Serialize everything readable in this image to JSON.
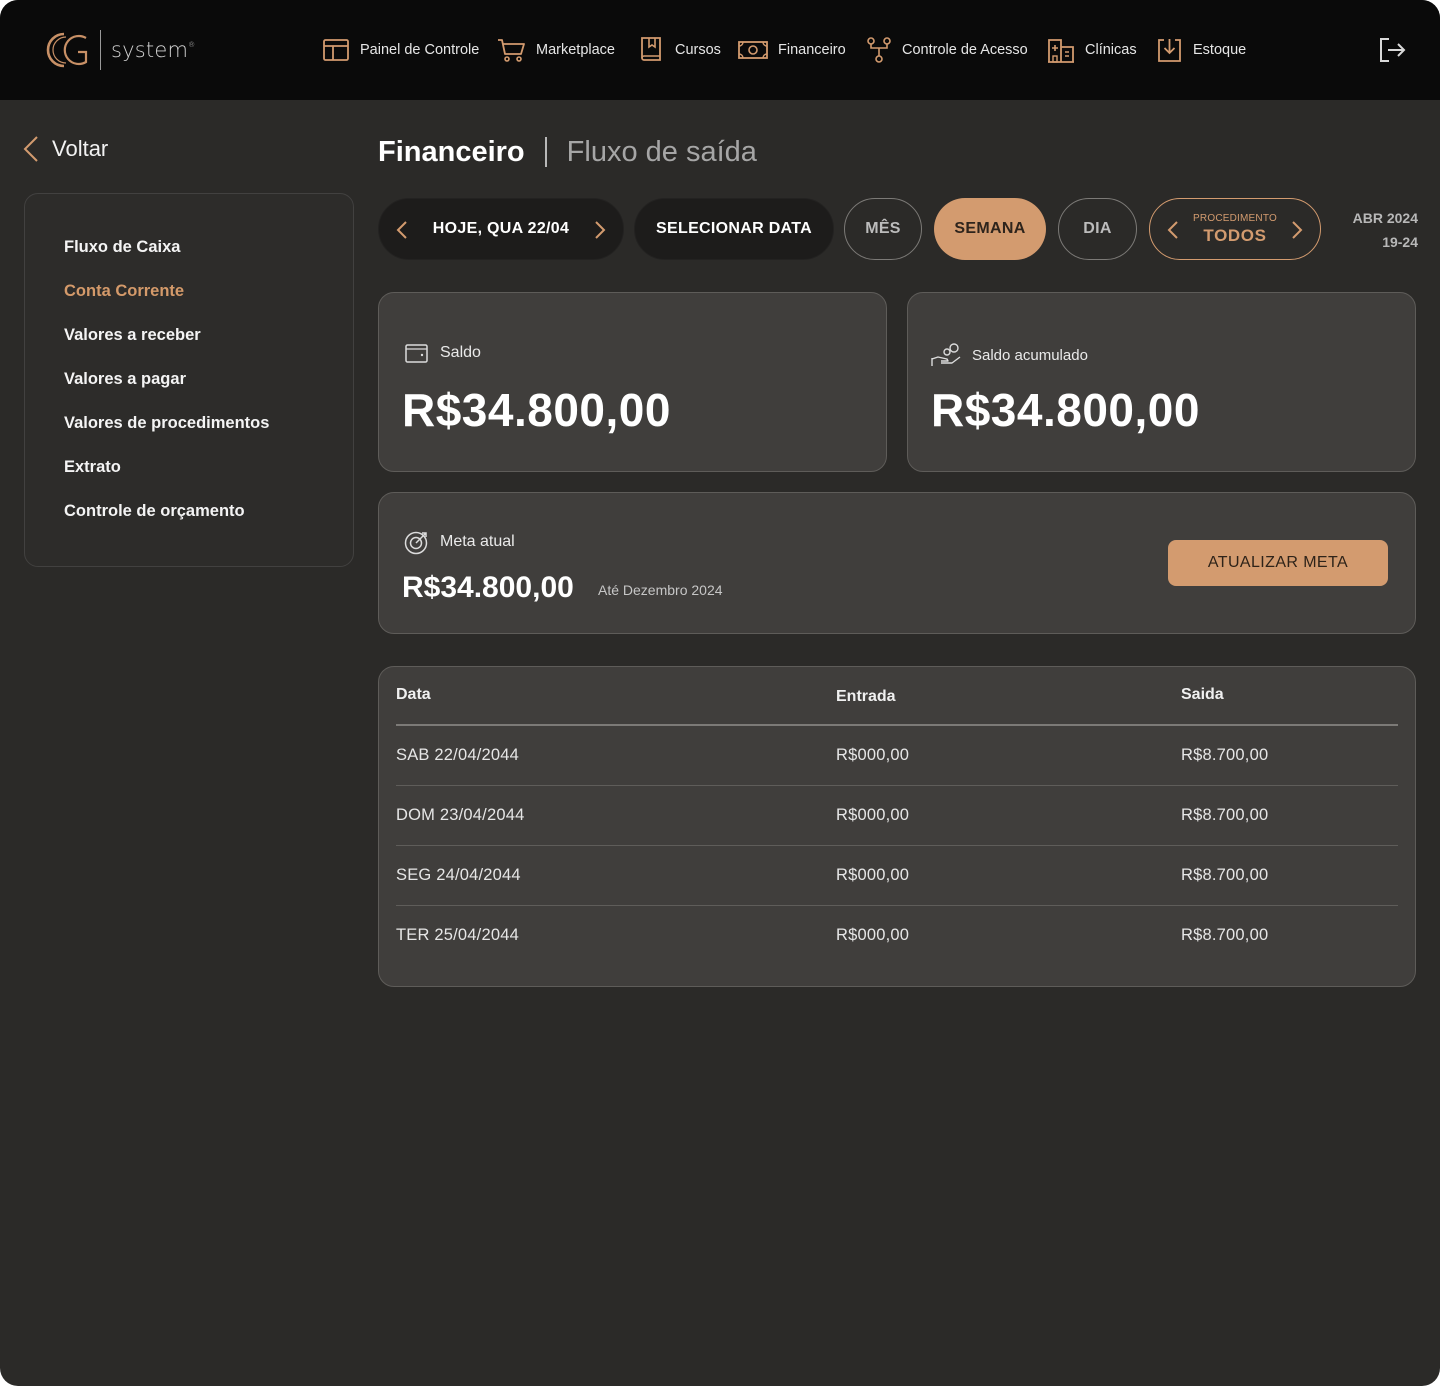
{
  "brand": {
    "name": "system",
    "mark": "®"
  },
  "nav": {
    "items": [
      {
        "label": "Painel de Controle",
        "icon": "layout-icon"
      },
      {
        "label": "Marketplace",
        "icon": "cart-icon"
      },
      {
        "label": "Cursos",
        "icon": "book-icon"
      },
      {
        "label": "Financeiro",
        "icon": "banknote-icon"
      },
      {
        "label": "Controle de Acesso",
        "icon": "network-icon"
      },
      {
        "label": "Clínicas",
        "icon": "building-icon"
      },
      {
        "label": "Estoque",
        "icon": "download-box-icon"
      }
    ],
    "logout_icon": "logout-icon"
  },
  "back": {
    "label": "Voltar"
  },
  "sidebar": {
    "items": [
      {
        "label": "Fluxo de Caixa",
        "active": false
      },
      {
        "label": "Conta Corrente",
        "active": true
      },
      {
        "label": "Valores a receber",
        "active": false
      },
      {
        "label": "Valores a pagar",
        "active": false
      },
      {
        "label": "Valores de procedimentos",
        "active": false
      },
      {
        "label": "Extrato",
        "active": false
      },
      {
        "label": "Controle de orçamento",
        "active": false
      }
    ]
  },
  "page": {
    "title": "Financeiro",
    "subtitle": "Fluxo de saída"
  },
  "filters": {
    "date_label": "HOJE, QUA 22/04",
    "select_date": "SELECIONAR DATA",
    "month": "MÊS",
    "week": "SEMANA",
    "day": "DIA",
    "selected": "SEMANA",
    "procedure_caption": "PROCEDIMENTO",
    "procedure_value": "TODOS",
    "period_month": "ABR 2024",
    "period_days": "19-24"
  },
  "cards": {
    "saldo": {
      "label": "Saldo",
      "value": "R$34.800,00"
    },
    "saldo_acumulado": {
      "label": "Saldo acumulado",
      "value": "R$34.800,00"
    },
    "meta": {
      "label": "Meta atual",
      "value": "R$34.800,00",
      "until": "Até Dezembro 2024",
      "button": "ATUALIZAR META"
    }
  },
  "table": {
    "headers": [
      "Data",
      "Entrada",
      "Saida"
    ],
    "rows": [
      [
        "SAB 22/04/2044",
        "R$000,00",
        "R$8.700,00"
      ],
      [
        "DOM 23/04/2044",
        "R$000,00",
        "R$8.700,00"
      ],
      [
        "SEG 24/04/2044",
        "R$000,00",
        "R$8.700,00"
      ],
      [
        "TER 25/04/2044",
        "R$000,00",
        "R$8.700,00"
      ]
    ]
  },
  "colors": {
    "accent": "#d39b6f",
    "background": "#2b2a28",
    "topbar": "#0a0a0a",
    "card": "#403e3c"
  }
}
